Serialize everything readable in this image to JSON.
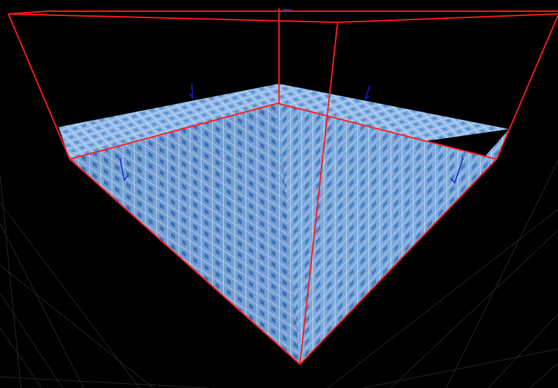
{
  "viewport": {
    "background": "#000000",
    "floor_grid_color": "#2b2b2b",
    "bounding_box_color": "#ff1a1a",
    "mesh_fill_color": "#6aa2dc",
    "mesh_line_color": "#e6f0fb",
    "mesh_shadow_color": "#2f5f99",
    "arrow_color": "#1020d0"
  }
}
